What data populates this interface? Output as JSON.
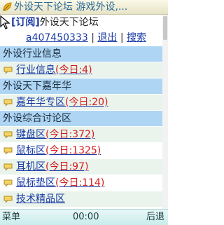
{
  "window": {
    "title": "外设天下论坛 游戏外设,..."
  },
  "user_bar": {
    "tag": "[订阅]",
    "site": "外设天下论坛"
  },
  "account_bar": {
    "username": "a407450333",
    "sep1": "|",
    "logout": "退出",
    "sep2": "|",
    "search": "搜索"
  },
  "sections": [
    {
      "title": "外设行业信息",
      "forums": [
        {
          "name": "行业信息",
          "today": "(今日:4)"
        }
      ]
    },
    {
      "title": "外设天下嘉年华",
      "forums": [
        {
          "name": "嘉年华专区",
          "today": "(今日:20)"
        }
      ]
    },
    {
      "title": "外设综合讨论区",
      "forums": [
        {
          "name": "键盘区",
          "today": "(今日:372)"
        },
        {
          "name": "鼠标区",
          "today": "(今日:1325)"
        },
        {
          "name": "耳机区",
          "today": "(今日:97)"
        },
        {
          "name": "鼠标垫区",
          "today": "(今日:114)"
        },
        {
          "name": "技术精品区",
          "today": ""
        }
      ]
    }
  ],
  "softkeys": {
    "left": "菜单",
    "center": "00:00",
    "right": "后退"
  },
  "colors": {
    "header_bg": "#aed6f4",
    "link": "#1a3aa5",
    "today": "#d61a1a",
    "title_text": "#2a6a9a"
  },
  "icons": {
    "title": "leaf-logo-icon",
    "bullet": "speech-bubble-icon",
    "pointer": "mouse-pointer-icon"
  }
}
